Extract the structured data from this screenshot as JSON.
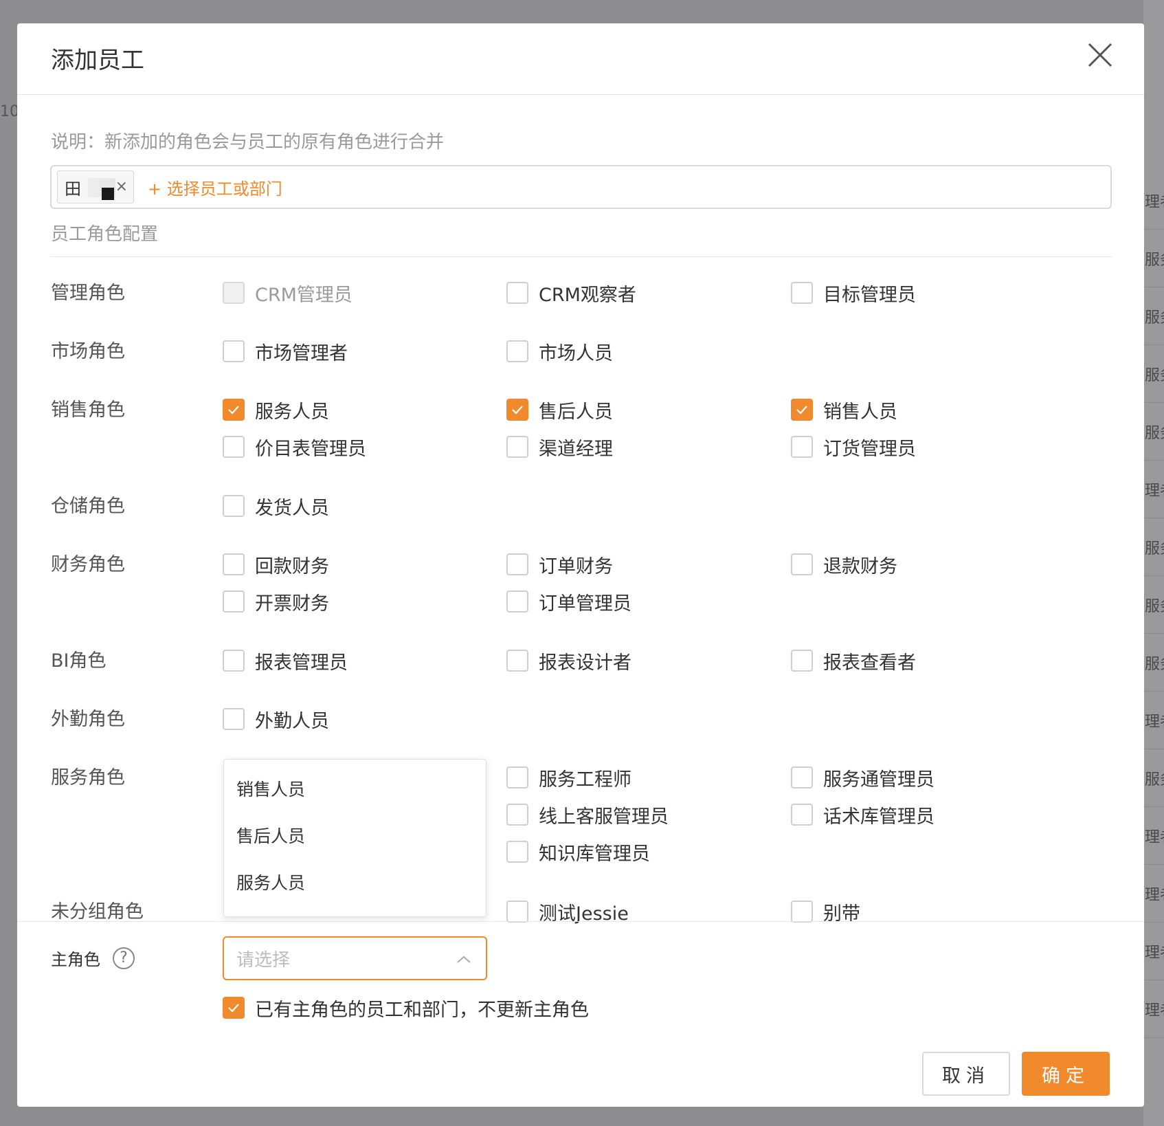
{
  "dialog": {
    "title": "添加员工",
    "note": "说明：新添加的角色会与员工的原有角色进行合并",
    "selected_tag": "田",
    "add_link": "+ 选择员工或部门",
    "section_title": "员工角色配置"
  },
  "background": {
    "left_text": "10",
    "right_rows": [
      "理者",
      "服务",
      "服务",
      "服务",
      "服务",
      "理者",
      "服务",
      "服务",
      "服务",
      "理者",
      "服务",
      "理者",
      "理者",
      "理者",
      "理者"
    ]
  },
  "groups": [
    {
      "label": "管理角色",
      "options": [
        {
          "label": "CRM管理员",
          "checked": false,
          "disabled": true
        },
        {
          "label": "CRM观察者",
          "checked": false
        },
        {
          "label": "目标管理员",
          "checked": false
        }
      ]
    },
    {
      "label": "市场角色",
      "options": [
        {
          "label": "市场管理者",
          "checked": false
        },
        {
          "label": "市场人员",
          "checked": false
        }
      ]
    },
    {
      "label": "销售角色",
      "options": [
        {
          "label": "服务人员",
          "checked": true
        },
        {
          "label": "售后人员",
          "checked": true
        },
        {
          "label": "销售人员",
          "checked": true
        },
        {
          "label": "价目表管理员",
          "checked": false
        },
        {
          "label": "渠道经理",
          "checked": false
        },
        {
          "label": "订货管理员",
          "checked": false
        }
      ]
    },
    {
      "label": "仓储角色",
      "options": [
        {
          "label": "发货人员",
          "checked": false
        }
      ]
    },
    {
      "label": "财务角色",
      "options": [
        {
          "label": "回款财务",
          "checked": false
        },
        {
          "label": "订单财务",
          "checked": false
        },
        {
          "label": "退款财务",
          "checked": false
        },
        {
          "label": "开票财务",
          "checked": false
        },
        {
          "label": "订单管理员",
          "checked": false
        }
      ]
    },
    {
      "label": "BI角色",
      "options": [
        {
          "label": "报表管理员",
          "checked": false
        },
        {
          "label": "报表设计者",
          "checked": false
        },
        {
          "label": "报表查看者",
          "checked": false
        }
      ]
    },
    {
      "label": "外勤角色",
      "options": [
        {
          "label": "外勤人员",
          "checked": false
        }
      ]
    },
    {
      "label": "服务角色",
      "options": [
        {
          "label": "服务工程师",
          "checked": false
        },
        {
          "label": "服务通管理员",
          "checked": false
        },
        {
          "label": "线上客服管理员",
          "checked": false
        },
        {
          "label": "话术库管理员",
          "checked": false
        },
        {
          "label": "知识库管理员",
          "checked": false
        }
      ]
    },
    {
      "label": "未分组角色",
      "options": [
        {
          "label": "测试Jessie",
          "checked": false
        },
        {
          "label": "别带",
          "checked": false
        }
      ]
    }
  ],
  "dropdown": {
    "items": [
      "销售人员",
      "售后人员",
      "服务人员"
    ]
  },
  "main_role": {
    "label": "主角色",
    "help_icon": "question-circle-icon",
    "placeholder": "请选择",
    "keep_label": "已有主角色的员工和部门，不更新主角色",
    "keep_checked": true
  },
  "buttons": {
    "cancel": "取消",
    "ok": "确定"
  },
  "colors": {
    "accent": "#f08a2c"
  }
}
